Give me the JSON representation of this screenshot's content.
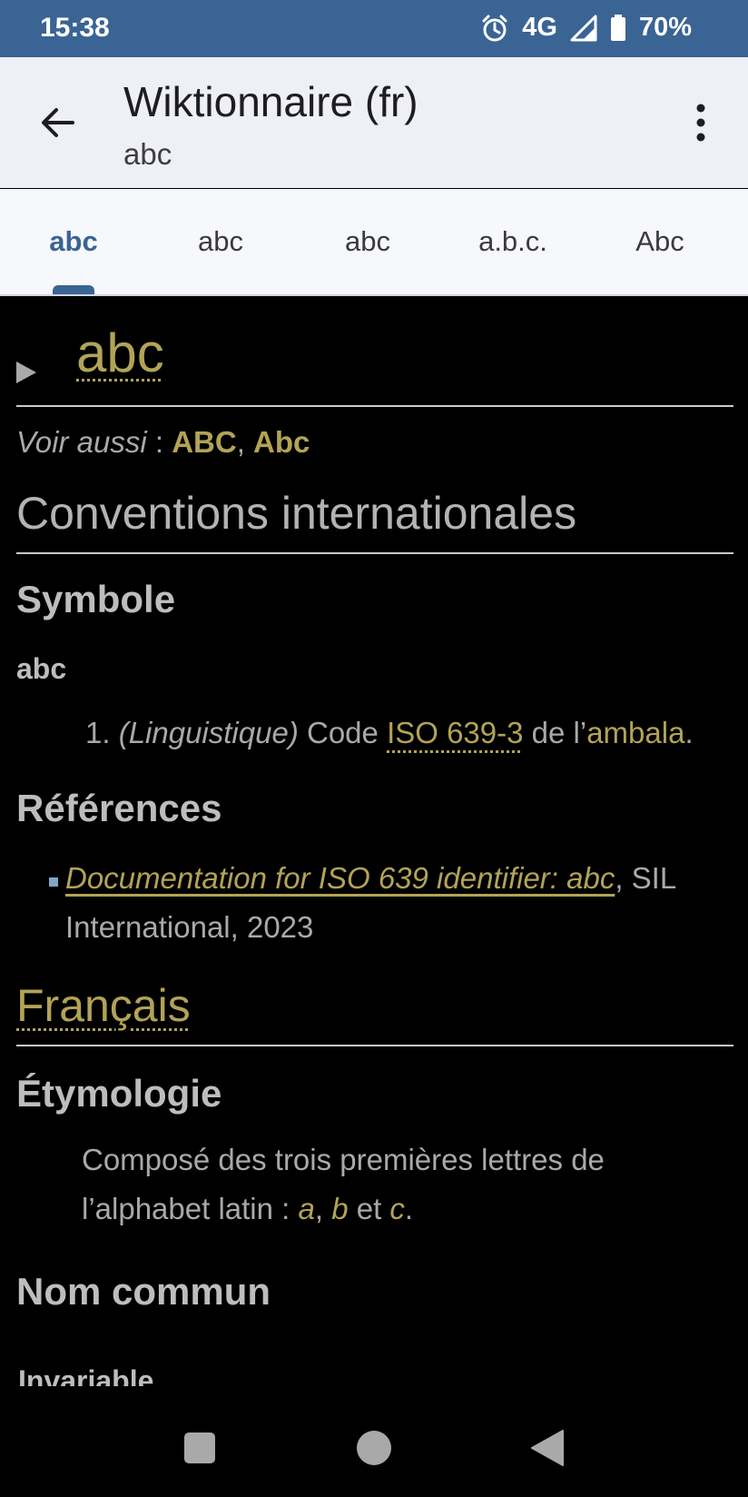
{
  "status_bar": {
    "time": "15:38",
    "network": "4G",
    "battery": "70%",
    "icons": [
      "alarm-icon",
      "signal-icon",
      "battery-icon"
    ]
  },
  "app_bar": {
    "title": "Wiktionnaire (fr)",
    "subtitle": "abc",
    "icons": [
      "back-arrow-icon",
      "overflow-menu-icon"
    ]
  },
  "tabs": [
    {
      "label": "abc",
      "active": true
    },
    {
      "label": "abc",
      "active": false
    },
    {
      "label": "abc",
      "active": false
    },
    {
      "label": "a.b.c.",
      "active": false
    },
    {
      "label": "Abc",
      "active": false
    }
  ],
  "article": {
    "title": "abc",
    "see_also_label": "Voir aussi",
    "see_also_sep": " : ",
    "see_also_links": [
      "ABC",
      "Abc"
    ],
    "sections": {
      "conventions": "Conventions internationales",
      "symbole": "Symbole",
      "symbole_word": "abc",
      "definition": {
        "number": "1.",
        "domain": "(Linguistique)",
        "text_before": "Code",
        "link1": "ISO 639-3",
        "text_mid": "de l’",
        "link2": "ambala",
        "text_after": "."
      },
      "references": "Références",
      "reference_item": {
        "link": "Documentation for ISO 639 identifier: abc",
        "after": ", SIL",
        "line2": "International, 2023"
      },
      "language": "Français",
      "etymologie": "Étymologie",
      "etymology": {
        "line1": "Composé des trois premières lettres de",
        "line2_before": "l’alphabet latin : ",
        "a": "a",
        "sep1": ", ",
        "b": "b",
        "sep2": " et ",
        "c": "c",
        "end": "."
      },
      "nom_commun": "Nom commun",
      "invariable": "Invariable"
    }
  },
  "nav_bar": {
    "icons": [
      "recents-square-icon",
      "home-circle-icon",
      "back-triangle-icon"
    ]
  },
  "colors": {
    "status_bar": "#3a6494",
    "accent": "#3a6494",
    "link_gold": "#b2a356",
    "text_gray": "#a9a9a9",
    "content_bg": "#000000"
  }
}
